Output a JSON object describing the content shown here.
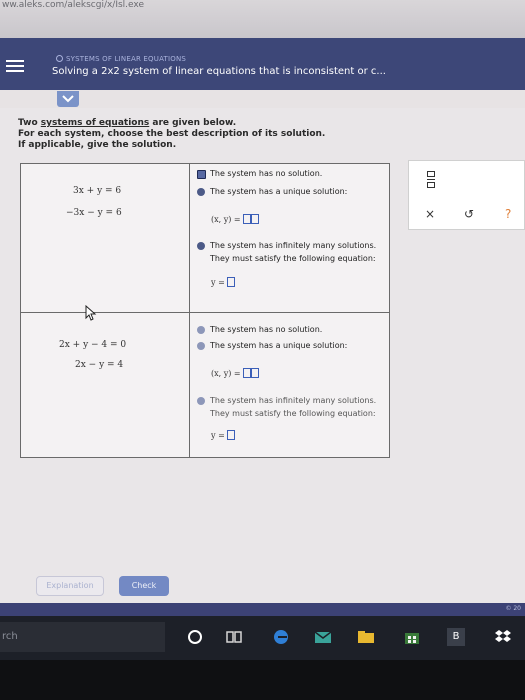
{
  "browser": {
    "url_fragment": "ww.aleks.com/alekscgi/x/Isl.exe"
  },
  "header": {
    "breadcrumb": "SYSTEMS OF LINEAR EQUATIONS",
    "title": "Solving a 2x2 system of linear equations that is inconsistent or c..."
  },
  "instructions": {
    "line1_prefix": "Two ",
    "line1_link": "systems of equations",
    "line1_suffix": " are given below.",
    "line2": "For each system, choose the best description of its solution.",
    "line3": "If applicable, give the solution."
  },
  "systems": [
    {
      "eq1": "3x + y  =  6",
      "eq2": "−3x − y  =  6",
      "options": {
        "no_solution": "The system has no solution.",
        "unique": "The system has a unique solution:",
        "unique_answer": "(x, y)  =",
        "infinite_line1": "The system has infinitely many solutions.",
        "infinite_line2": "They must satisfy the following equation:",
        "infinite_answer": "y  ="
      },
      "selected": "no_solution"
    },
    {
      "eq1": "2x + y − 4  =  0",
      "eq2": "2x − y  =  4",
      "options": {
        "no_solution": "The system has no solution.",
        "unique": "The system has a unique solution:",
        "unique_answer": "(x, y)  =",
        "infinite_line1": "The system has infinitely many solutions.",
        "infinite_line2": "They must satisfy the following equation:",
        "infinite_answer": "y  ="
      },
      "selected": null
    }
  ],
  "toolbar": {
    "close": "×",
    "undo": "↺",
    "help": "?"
  },
  "buttons": {
    "explanation": "Explanation",
    "check": "Check"
  },
  "footer": {
    "copyright": "© 20"
  },
  "taskbar": {
    "search_stub": "rch",
    "letter_icon": "B"
  },
  "colors": {
    "header": "#3d4778",
    "check": "#7389c4",
    "help": "#e0803a"
  }
}
